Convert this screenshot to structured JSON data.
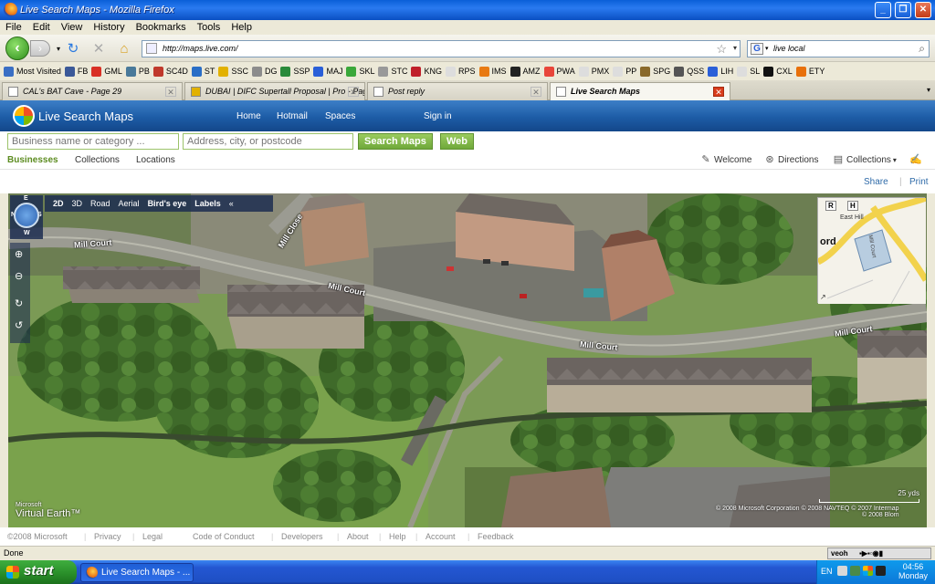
{
  "window": {
    "title": "Live Search Maps - Mozilla Firefox"
  },
  "menu": [
    "File",
    "Edit",
    "View",
    "History",
    "Bookmarks",
    "Tools",
    "Help"
  ],
  "nav": {
    "url": "http://maps.live.com/",
    "search_value": "live local"
  },
  "bookmarks": [
    {
      "label": "Most Visited",
      "color": "#3a6fc4"
    },
    {
      "label": "FB",
      "color": "#3b5998"
    },
    {
      "label": "GML",
      "color": "#d93025"
    },
    {
      "label": "PB",
      "color": "#4a7a9a"
    },
    {
      "label": "SC4D",
      "color": "#c0392b"
    },
    {
      "label": "ST",
      "color": "#2a6ec6"
    },
    {
      "label": "SSC",
      "color": "#e2b100"
    },
    {
      "label": "DG",
      "color": "#8c8c8c"
    },
    {
      "label": "SSP",
      "color": "#2a8a3a"
    },
    {
      "label": "MAJ",
      "color": "#2a5fd8"
    },
    {
      "label": "SKL",
      "color": "#3aa83a"
    },
    {
      "label": "STC",
      "color": "#999999"
    },
    {
      "label": "KNG",
      "color": "#c0202a"
    },
    {
      "label": "RPS",
      "color": "#dddddd"
    },
    {
      "label": "IMS",
      "color": "#e87a12"
    },
    {
      "label": "AMZ",
      "color": "#222222"
    },
    {
      "label": "PWA",
      "color": "#e8463a"
    },
    {
      "label": "PMX",
      "color": "#dddddd"
    },
    {
      "label": "PP",
      "color": "#dddddd"
    },
    {
      "label": "SPG",
      "color": "#8a6a2a"
    },
    {
      "label": "QSS",
      "color": "#555555"
    },
    {
      "label": "LIH",
      "color": "#2a5fd8"
    },
    {
      "label": "SL",
      "color": "#dddddd"
    },
    {
      "label": "CXL",
      "color": "#111111"
    },
    {
      "label": "ETY",
      "color": "#e8700a"
    }
  ],
  "tabs": [
    {
      "label": "CAL's BAT Cave - Page 29"
    },
    {
      "label": "DUBAI | DIFC Supertall Proposal | Pro - Pag..."
    },
    {
      "label": "Post reply"
    },
    {
      "label": "Live Search Maps"
    }
  ],
  "site": {
    "brand": "Live Search Maps",
    "topnav": [
      "Home",
      "Hotmail",
      "Spaces",
      "Sign in"
    ],
    "what_placeholder": "Business name or category ...",
    "where_placeholder": "Address, city, or postcode",
    "search_btn": "Search Maps",
    "web_btn": "Web",
    "subnav": [
      "Businesses",
      "Collections",
      "Locations"
    ],
    "welcome": "Welcome",
    "directions": "Directions",
    "collections_menu": "Collections",
    "share": "Share",
    "print": "Print"
  },
  "map": {
    "toolbar": [
      "2D",
      "3D",
      "Road",
      "Aerial",
      "Bird's eye",
      "Labels",
      "«"
    ],
    "compass": {
      "n": "N",
      "e": "E",
      "s": "S",
      "w": "W"
    },
    "streets": [
      "Mill Court",
      "Mill Close",
      "Mill Court",
      "Mill Court",
      "Mill Court"
    ],
    "minimap": {
      "r": "R",
      "h": "H",
      "label_hill": "East Hill",
      "label_ord": "ord",
      "label_court": "Mill Court"
    },
    "scale": "25 yds",
    "logo_small": "Microsoft",
    "logo_big": "Virtual Earth™",
    "copyright": "© 2008 Microsoft Corporation   © 2008 NAVTEQ   © 2007 Intermap",
    "copyright2": "© 2008 Blom"
  },
  "footer": [
    "©2008 Microsoft",
    "Privacy",
    "Legal",
    "Code of Conduct",
    "Developers",
    "About",
    "Help",
    "Account",
    "Feedback"
  ],
  "status": {
    "text": "Done",
    "veoh": "veoh"
  },
  "taskbar": {
    "start": "start",
    "item": "Live Search Maps - ...",
    "lang": "EN",
    "time": "04:56",
    "day": "Monday"
  }
}
